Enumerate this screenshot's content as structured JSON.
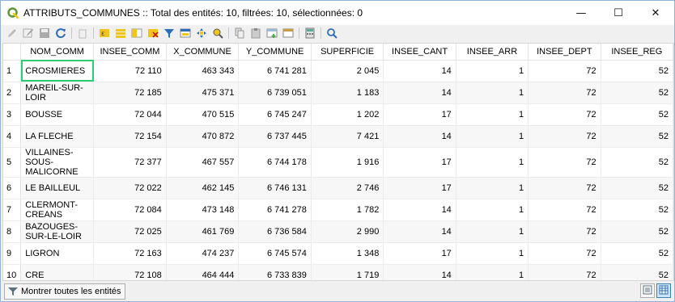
{
  "window": {
    "title": "ATTRIBUTS_COMMUNES :: Total des entités: 10, filtrées: 10, sélectionnées: 0",
    "minimize_glyph": "—",
    "maximize_glyph": "☐",
    "close_glyph": "✕"
  },
  "toolbar": {
    "icons": [
      "edit-pencil-icon",
      "multi-edit-icon",
      "save-edits-icon",
      "reload-icon",
      "delete-feature-icon",
      "select-by-expression-icon",
      "select-all-icon",
      "invert-selection-icon",
      "deselect-all-icon",
      "filter-select-icon",
      "move-selection-to-top-icon",
      "pan-to-selection-icon",
      "zoom-to-selection-icon",
      "copy-icon",
      "paste-icon",
      "new-field-icon",
      "delete-field-icon",
      "field-calculator-icon",
      "conditional-formatting-icon"
    ]
  },
  "table": {
    "columns": [
      "NOM_COMM",
      "INSEE_COMM",
      "X_COMMUNE",
      "Y_COMMUNE",
      "SUPERFICIE",
      "INSEE_CANT",
      "INSEE_ARR",
      "INSEE_DEPT",
      "INSEE_REG"
    ],
    "rows": [
      {
        "n": "1",
        "cells": [
          "CROSMIERES",
          "72 110",
          "463 343",
          "6 741 281",
          "2 045",
          "14",
          "1",
          "72",
          "52"
        ]
      },
      {
        "n": "2",
        "cells": [
          "MAREIL-SUR-LOIR",
          "72 185",
          "475 371",
          "6 739 051",
          "1 183",
          "14",
          "1",
          "72",
          "52"
        ]
      },
      {
        "n": "3",
        "cells": [
          "BOUSSE",
          "72 044",
          "470 515",
          "6 745 247",
          "1 202",
          "17",
          "1",
          "72",
          "52"
        ]
      },
      {
        "n": "4",
        "cells": [
          "LA FLECHE",
          "72 154",
          "470 872",
          "6 737 445",
          "7 421",
          "14",
          "1",
          "72",
          "52"
        ]
      },
      {
        "n": "5",
        "cells": [
          "VILLAINES-SOUS-MALICORNE",
          "72 377",
          "467 557",
          "6 744 178",
          "1 916",
          "17",
          "1",
          "72",
          "52"
        ]
      },
      {
        "n": "6",
        "cells": [
          "LE BAILLEUL",
          "72 022",
          "462 145",
          "6 746 131",
          "2 746",
          "17",
          "1",
          "72",
          "52"
        ]
      },
      {
        "n": "7",
        "cells": [
          "CLERMONT-CREANS",
          "72 084",
          "473 148",
          "6 741 278",
          "1 782",
          "14",
          "1",
          "72",
          "52"
        ]
      },
      {
        "n": "8",
        "cells": [
          "BAZOUGES-SUR-LE-LOIR",
          "72 025",
          "461 769",
          "6 736 584",
          "2 990",
          "14",
          "1",
          "72",
          "52"
        ]
      },
      {
        "n": "9",
        "cells": [
          "LIGRON",
          "72 163",
          "474 237",
          "6 745 574",
          "1 348",
          "17",
          "1",
          "72",
          "52"
        ]
      },
      {
        "n": "10",
        "cells": [
          "CRE",
          "72 108",
          "464 444",
          "6 733 839",
          "1 719",
          "14",
          "1",
          "72",
          "52"
        ]
      }
    ]
  },
  "bottom": {
    "show_all_label": "Montrer toutes les entités"
  },
  "colors": {
    "accent": "#2ecc71",
    "qgis_green": "#589632",
    "qgis_yellow": "#f0c419"
  }
}
